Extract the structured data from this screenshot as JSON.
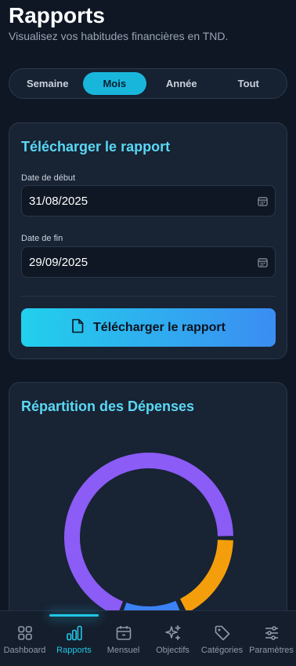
{
  "header": {
    "title": "Rapports",
    "subtitle": "Visualisez vos habitudes financières en TND."
  },
  "period_tabs": [
    "Semaine",
    "Mois",
    "Année",
    "Tout"
  ],
  "period_selected": "Mois",
  "download_card": {
    "title": "Télécharger le rapport",
    "start_label": "Date de début",
    "start_value": "31/08/2025",
    "end_label": "Date de fin",
    "end_value": "29/09/2025",
    "button_label": "Télécharger le rapport"
  },
  "chart_card": {
    "title": "Répartition des Dépenses"
  },
  "chart_data": {
    "type": "pie",
    "donut": true,
    "colors": [
      "#8b5cf6",
      "#f59e0b",
      "#3b82f6"
    ]
  },
  "bottom_nav": {
    "items": [
      {
        "label": "Dashboard",
        "icon": "grid-icon"
      },
      {
        "label": "Rapports",
        "icon": "bar-chart-icon"
      },
      {
        "label": "Mensuel",
        "icon": "calendar-icon"
      },
      {
        "label": "Objectifs",
        "icon": "sparkles-icon"
      },
      {
        "label": "Catégories",
        "icon": "tag-icon"
      },
      {
        "label": "Paramètres",
        "icon": "sliders-icon"
      }
    ],
    "active": "Rapports"
  },
  "colors": {
    "accent": "#22c6e6",
    "card_title": "#5ad8f4",
    "background": "#0f1725"
  }
}
